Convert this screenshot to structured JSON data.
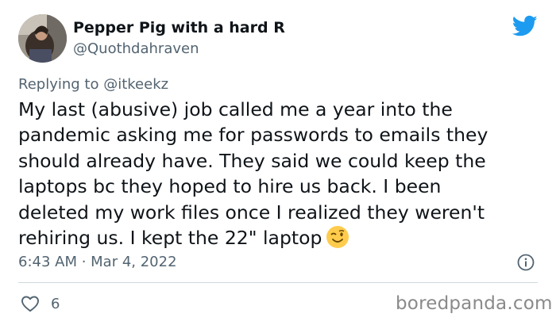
{
  "tweet": {
    "author": {
      "display_name": "Pepper Pig with a hard R",
      "handle": "@Quothdahraven"
    },
    "reply_context": {
      "prefix": "Replying to",
      "mention": "@itkeekz"
    },
    "body_lines": [
      "My last (abusive) job called me a year into the",
      "pandemic asking me for passwords to emails they",
      "should already have. They said we could keep the",
      "laptops bc they hoped to hire us back. I been",
      "deleted my work files once I realized they weren't",
      "rehiring us. I kept the 22\" laptop"
    ],
    "emoji": "winking-face",
    "timestamp": "6:43 AM · Mar 4, 2022",
    "like_count": "6"
  },
  "brand": {
    "platform_icon": "twitter-bird-icon",
    "accent_color": "#1d9bf0"
  },
  "watermark": "boredpanda.com"
}
